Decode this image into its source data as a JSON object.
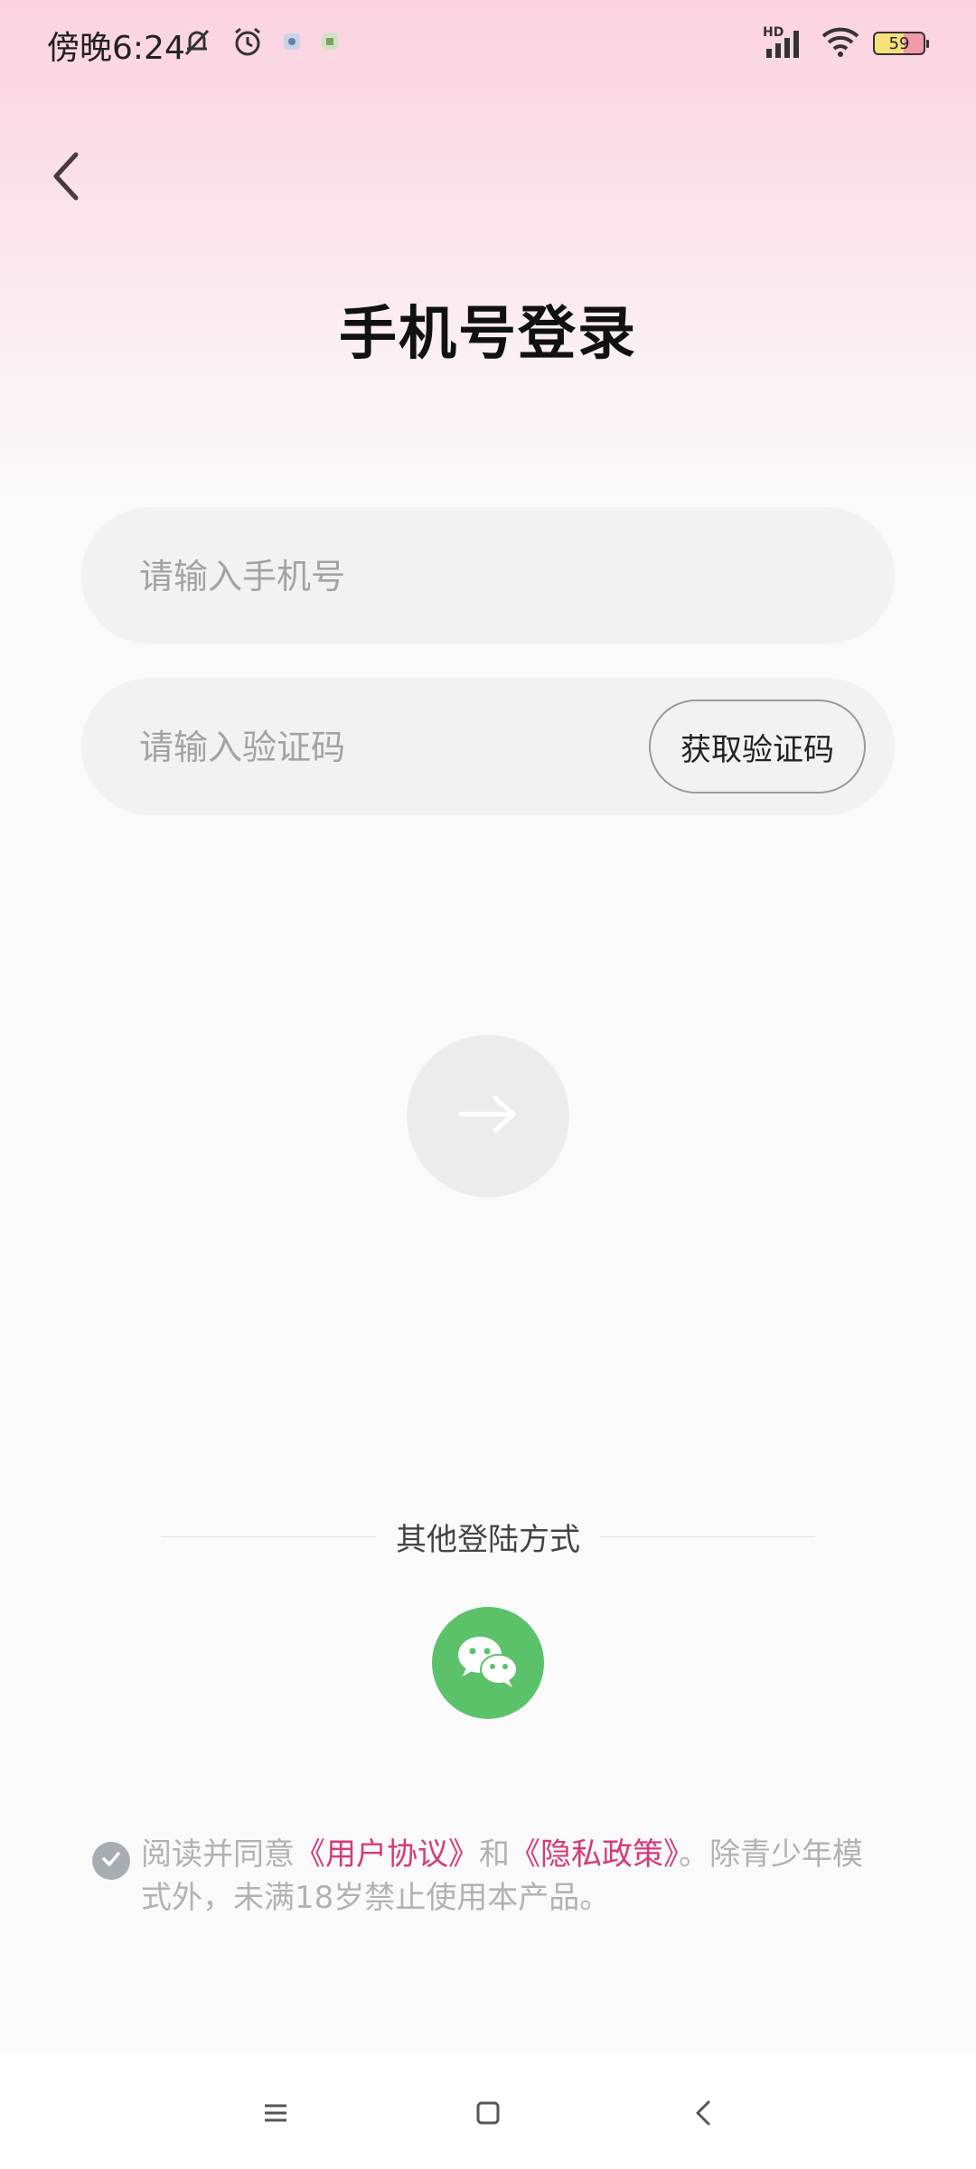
{
  "status_bar": {
    "time": "傍晚6:24",
    "battery_level": "59",
    "network_label": "HD",
    "icons": [
      "mute-bell-icon",
      "alarm-icon",
      "app-notification-icon",
      "app-notification-icon",
      "signal-icon",
      "wifi-icon",
      "battery-icon"
    ]
  },
  "header": {
    "back_icon": "chevron-left-icon",
    "title": "手机号登录"
  },
  "form": {
    "phone_placeholder": "请输入手机号",
    "code_placeholder": "请输入验证码",
    "get_code_label": "获取验证码",
    "submit_icon": "arrow-right-icon"
  },
  "other_login": {
    "label": "其他登陆方式",
    "wechat_icon": "wechat-icon"
  },
  "agreement": {
    "prefix": "阅读并同意",
    "user_agreement": "《用户协议》",
    "and": "和",
    "privacy_policy": "《隐私政策》",
    "suffix": "。除青少年模式外，未满18岁禁止使用本产品。"
  },
  "nav_bar": {
    "icons": [
      "menu-icon",
      "home-icon",
      "back-icon"
    ]
  },
  "colors": {
    "accent_link": "#d63a78",
    "wechat_green": "#5bc26a",
    "header_gradient_top": "#fbd3e0"
  }
}
